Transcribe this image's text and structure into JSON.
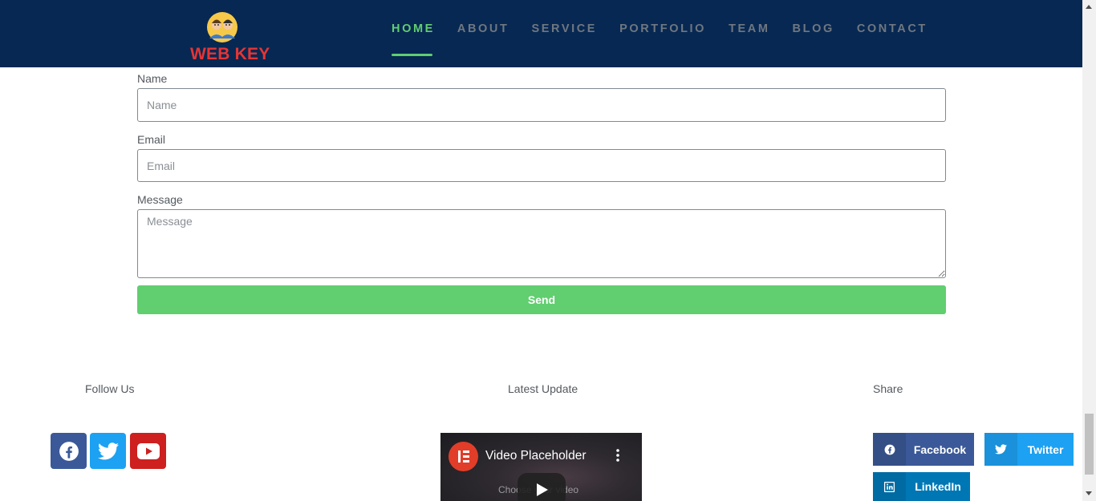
{
  "header": {
    "logo_text": "WEB KEY",
    "nav": [
      "HOME",
      "ABOUT",
      "SERVICE",
      "PORTFOLIO",
      "TEAM",
      "BLOG",
      "CONTACT"
    ],
    "active_index": 0
  },
  "form": {
    "name_label": "Name",
    "name_placeholder": "Name",
    "email_label": "Email",
    "email_placeholder": "Email",
    "message_label": "Message",
    "message_placeholder": "Message",
    "send_label": "Send"
  },
  "footer": {
    "follow_heading": "Follow Us",
    "latest_heading": "Latest Update",
    "share_heading": "Share",
    "social_icons": [
      "facebook-icon",
      "twitter-icon",
      "youtube-icon"
    ],
    "video": {
      "title": "Video Placeholder",
      "subtitle": "Choose your video"
    },
    "share": {
      "facebook": "Facebook",
      "twitter": "Twitter",
      "linkedin": "LinkedIn"
    }
  },
  "colors": {
    "header_bg": "#072852",
    "accent": "#61ce70",
    "logo_red": "#e73434",
    "facebook": "#3b5998",
    "twitter": "#1da1f2",
    "youtube": "#cd201f",
    "linkedin": "#0077b5"
  }
}
